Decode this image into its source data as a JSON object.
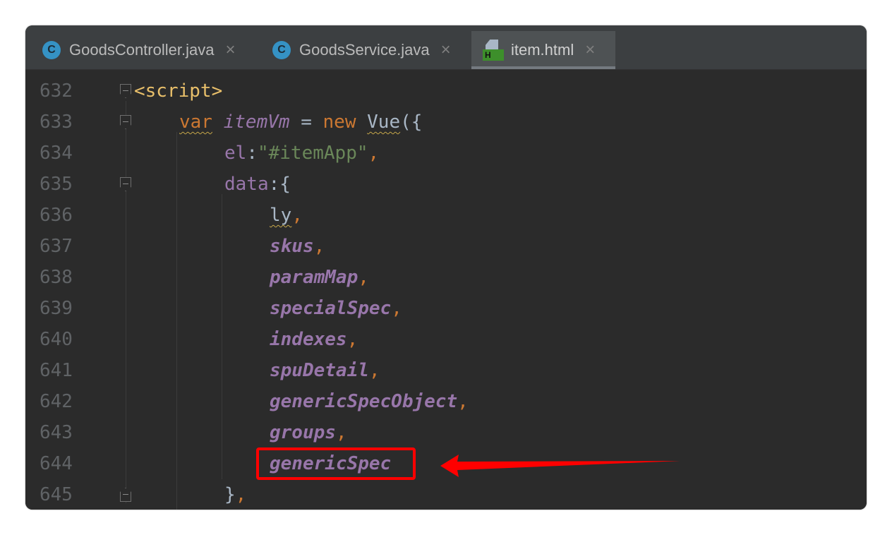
{
  "tabs": [
    {
      "label": "GoodsController.java",
      "icon": "java-class-icon",
      "active": false
    },
    {
      "label": "GoodsService.java",
      "icon": "java-class-icon",
      "active": false
    },
    {
      "label": "item.html",
      "icon": "html-file-icon",
      "active": true
    }
  ],
  "tab_icon_letters": {
    "class": "C",
    "html": "H"
  },
  "close_glyph": "×",
  "lines": [
    {
      "number": "632",
      "open_tag": "<script>"
    },
    {
      "number": "633",
      "keyword_var": "var",
      "name": "itemVm",
      "equals": " = ",
      "keyword_new": "new",
      "ctor": "Vue",
      "paren": "({"
    },
    {
      "number": "634",
      "key": "el",
      "colon": ":",
      "value": "\"#itemApp\"",
      "comma": ","
    },
    {
      "number": "635",
      "key": "data",
      "colon": ":",
      "brace": "{"
    },
    {
      "number": "636",
      "field": "ly",
      "comma": ","
    },
    {
      "number": "637",
      "field": "skus",
      "comma": ","
    },
    {
      "number": "638",
      "field": "paramMap",
      "comma": ","
    },
    {
      "number": "639",
      "field": "specialSpec",
      "comma": ","
    },
    {
      "number": "640",
      "field": "indexes",
      "comma": ","
    },
    {
      "number": "641",
      "field": "spuDetail",
      "comma": ","
    },
    {
      "number": "642",
      "field": "genericSpecObject",
      "comma": ","
    },
    {
      "number": "643",
      "field": "groups",
      "comma": ","
    },
    {
      "number": "644",
      "field": "genericSpec"
    },
    {
      "number": "645",
      "close": "}",
      "comma": ","
    }
  ],
  "annotation": {
    "color": "#ff0000",
    "target": "genericSpec"
  },
  "colors": {
    "background": "#2b2b2b",
    "tabbar": "#3c3f41",
    "tag": "#e8bf6a",
    "keyword": "#cc7832",
    "string": "#6a8759",
    "field": "#9876aa",
    "line_number": "#606366"
  }
}
